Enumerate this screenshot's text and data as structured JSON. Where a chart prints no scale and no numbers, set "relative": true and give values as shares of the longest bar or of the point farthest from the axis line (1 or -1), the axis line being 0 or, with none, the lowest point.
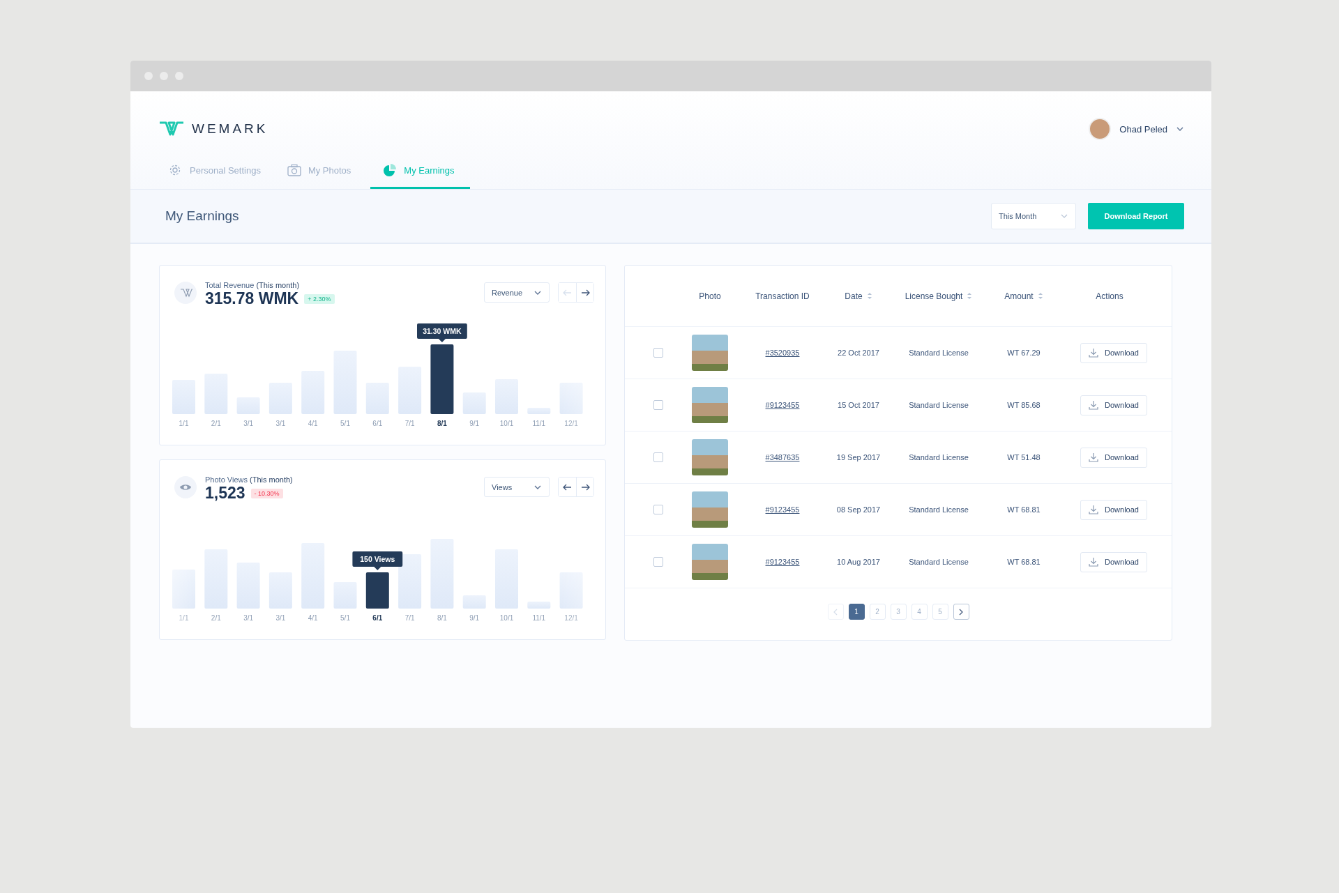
{
  "brand": {
    "name": "WEMARK"
  },
  "user": {
    "name": "Ohad Peled"
  },
  "tabs": [
    {
      "label": "Personal Settings",
      "kind": "settings",
      "selected": false
    },
    {
      "label": "My Photos",
      "kind": "photos",
      "selected": false
    },
    {
      "label": "My Earnings",
      "kind": "earnings",
      "selected": true
    }
  ],
  "page": {
    "title": "My Earnings",
    "period": "This Month",
    "action": "Download Report"
  },
  "stats": [
    {
      "kind": "revenue",
      "title": "Total Revenue **(This month)**",
      "value": "315.78 WMK",
      "change": {
        "text": "+ 2.30%",
        "kind": "up"
      },
      "selector": "Revenue",
      "prev_disabled": true,
      "chart_data": {
        "type": "bar",
        "categories": [
          "1/1",
          "2/1",
          "3/1",
          "3/1",
          "4/1",
          "5/1",
          "6/1",
          "7/1",
          "8/1",
          "9/1",
          "10/1",
          "11/1",
          "12/1"
        ],
        "values": [
          0.49,
          0.58,
          0.24,
          0.45,
          0.62,
          0.91,
          0.45,
          0.68,
          1,
          0.31,
          0.5,
          0.09,
          0.45
        ],
        "relative": true,
        "annotations": [
          "31.30 WMK"
        ]
      },
      "bars": [
        {
          "selected": false
        },
        {
          "selected": false
        },
        {
          "selected": false
        },
        {
          "selected": false
        },
        {
          "selected": false
        },
        {
          "selected": false
        },
        {
          "selected": false
        },
        {
          "selected": false
        },
        {
          "selected": true
        },
        {
          "selected": false
        },
        {
          "selected": false
        },
        {
          "selected": false
        },
        {
          "selected": false
        }
      ]
    },
    {
      "kind": "views",
      "title": "Photo Views **(This month)**",
      "value": "1,523",
      "change": {
        "text": "- 10.30%",
        "kind": "down"
      },
      "selector": "Views",
      "prev_disabled": false,
      "chart_data": {
        "type": "bar",
        "categories": [
          "1/1",
          "2/1",
          "3/1",
          "3/1",
          "4/1",
          "5/1",
          "6/1",
          "7/1",
          "8/1",
          "9/1",
          "10/1",
          "11/1",
          "12/1"
        ],
        "values": [
          0.56,
          0.85,
          0.66,
          0.52,
          0.94,
          0.38,
          0.52,
          0.78,
          1,
          0.19,
          0.85,
          0.1,
          0.52
        ],
        "relative": true,
        "annotations": [
          "150 Views"
        ]
      },
      "bars": [
        {
          "selected": false
        },
        {
          "selected": false
        },
        {
          "selected": false
        },
        {
          "selected": false
        },
        {
          "selected": false
        },
        {
          "selected": false
        },
        {
          "selected": true
        },
        {
          "selected": false
        },
        {
          "selected": false
        },
        {
          "selected": false
        },
        {
          "selected": false
        },
        {
          "selected": false
        },
        {
          "selected": false
        }
      ]
    }
  ],
  "table": {
    "columns": [
      {
        "label": "Photo",
        "sortable": false
      },
      {
        "label": "Transaction ID",
        "sortable": false
      },
      {
        "label": "Date",
        "sortable": true
      },
      {
        "label": "License Bought",
        "sortable": true
      },
      {
        "label": "Amount",
        "sortable": true
      },
      {
        "label": "Actions",
        "sortable": false
      }
    ],
    "rows": [
      {
        "checked": false,
        "transaction_id": "#3520935",
        "date": "22 Oct 2017",
        "license": "Standard License",
        "amount": "WT 67.29",
        "action": "Download"
      },
      {
        "checked": false,
        "transaction_id": "#9123455",
        "date": "15 Oct 2017",
        "license": "Standard License",
        "amount": "WT 85.68",
        "action": "Download"
      },
      {
        "checked": false,
        "transaction_id": "#3487635",
        "date": "19 Sep 2017",
        "license": "Standard License",
        "amount": "WT 51.48",
        "action": "Download"
      },
      {
        "checked": false,
        "transaction_id": "#9123455",
        "date": "08 Sep 2017",
        "license": "Standard License",
        "amount": "WT 68.81",
        "action": "Download"
      },
      {
        "checked": false,
        "transaction_id": "#9123455",
        "date": "10 Aug 2017",
        "license": "Standard License",
        "amount": "WT 68.81",
        "action": "Download"
      }
    ]
  },
  "pagination": {
    "prev_disabled": true,
    "next_disabled": false,
    "pages": [
      {
        "label": "1",
        "selected": true
      },
      {
        "label": "2",
        "selected": false
      },
      {
        "label": "3",
        "selected": false
      },
      {
        "label": "4",
        "selected": false
      },
      {
        "label": "5",
        "selected": false
      }
    ]
  }
}
